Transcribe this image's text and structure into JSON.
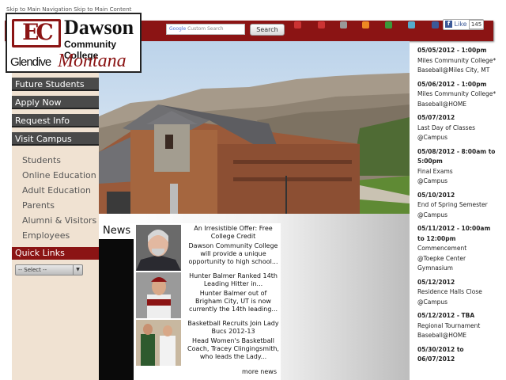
{
  "skip_links": "Skip to Main Navigation Skip to Main Content",
  "logo": {
    "mark": "EC",
    "name_line1": "Dawson",
    "name_line2": "Community College",
    "city": "Glendive",
    "state": "Montana"
  },
  "search": {
    "placeholder": "Custom Search",
    "google_label": "Google",
    "button": "Search"
  },
  "facebook": {
    "like_label": "Like",
    "like_count": "145"
  },
  "social_icons": [
    {
      "name": "google-plus-icon",
      "color": "#cc3333"
    },
    {
      "name": "email-icon",
      "color": "#cc3333"
    },
    {
      "name": "print-icon",
      "color": "#999999"
    },
    {
      "name": "rss-icon",
      "color": "#ee8822"
    },
    {
      "name": "share-icon",
      "color": "#3a9a3a"
    },
    {
      "name": "mobile-icon",
      "color": "#55aacc"
    },
    {
      "name": "facebook-icon",
      "color": "#3b5998"
    }
  ],
  "nav": {
    "main": [
      "Future Students",
      "Apply Now",
      "Request Info",
      "Visit Campus"
    ],
    "sub": [
      "Students",
      "Online Education",
      "Adult Education",
      "Parents",
      "Alumni & Visitors",
      "Employees"
    ],
    "quick_links": "Quick Links",
    "select_value": "-- Select --"
  },
  "news": {
    "heading": "News",
    "items": [
      {
        "title": "An Irresistible Offer: Free College Credit",
        "summary": "Dawson Community College will provide a unique opportunity to high school..."
      },
      {
        "title": "Hunter Balmer Ranked 14th Leading Hitter in...",
        "summary": "Hunter Balmer out of Brigham City, UT is now currently the 14th leading..."
      },
      {
        "title": "Basketball Recruits Join Lady Bucs 2012-13",
        "summary": "Head Women's Basketball Coach, Tracey Clingingsmith, who leads the Lady..."
      }
    ],
    "more": "more news"
  },
  "events": [
    {
      "date": "05/05/2012 - 1:00pm",
      "lines": [
        "Miles Community College*",
        "Baseball@Miles City, MT"
      ]
    },
    {
      "date": "05/06/2012 - 1:00pm",
      "lines": [
        "Miles Community College*",
        "Baseball@HOME"
      ]
    },
    {
      "date": "05/07/2012",
      "lines": [
        "Last Day of Classes",
        "@Campus"
      ]
    },
    {
      "date": "05/08/2012 - 8:00am to 5:00pm",
      "lines": [
        "Final Exams",
        "@Campus"
      ]
    },
    {
      "date": "05/10/2012",
      "lines": [
        "End of Spring Semester",
        "@Campus"
      ]
    },
    {
      "date": "05/11/2012 - 10:00am to 12:00pm",
      "lines": [
        "Commencement",
        "@Toepke Center",
        "Gymnasium"
      ]
    },
    {
      "date": "05/12/2012",
      "lines": [
        "Residence Halls Close",
        "@Campus"
      ]
    },
    {
      "date": "05/12/2012 - TBA",
      "lines": [
        "Regional Tournament",
        "Baseball@HOME"
      ]
    },
    {
      "date": "05/30/2012 to 06/07/2012",
      "lines": []
    }
  ],
  "colors": {
    "brand": "#8b1414",
    "nav_dark": "#4a4a4a",
    "sidebar": "#f0e2d2"
  }
}
